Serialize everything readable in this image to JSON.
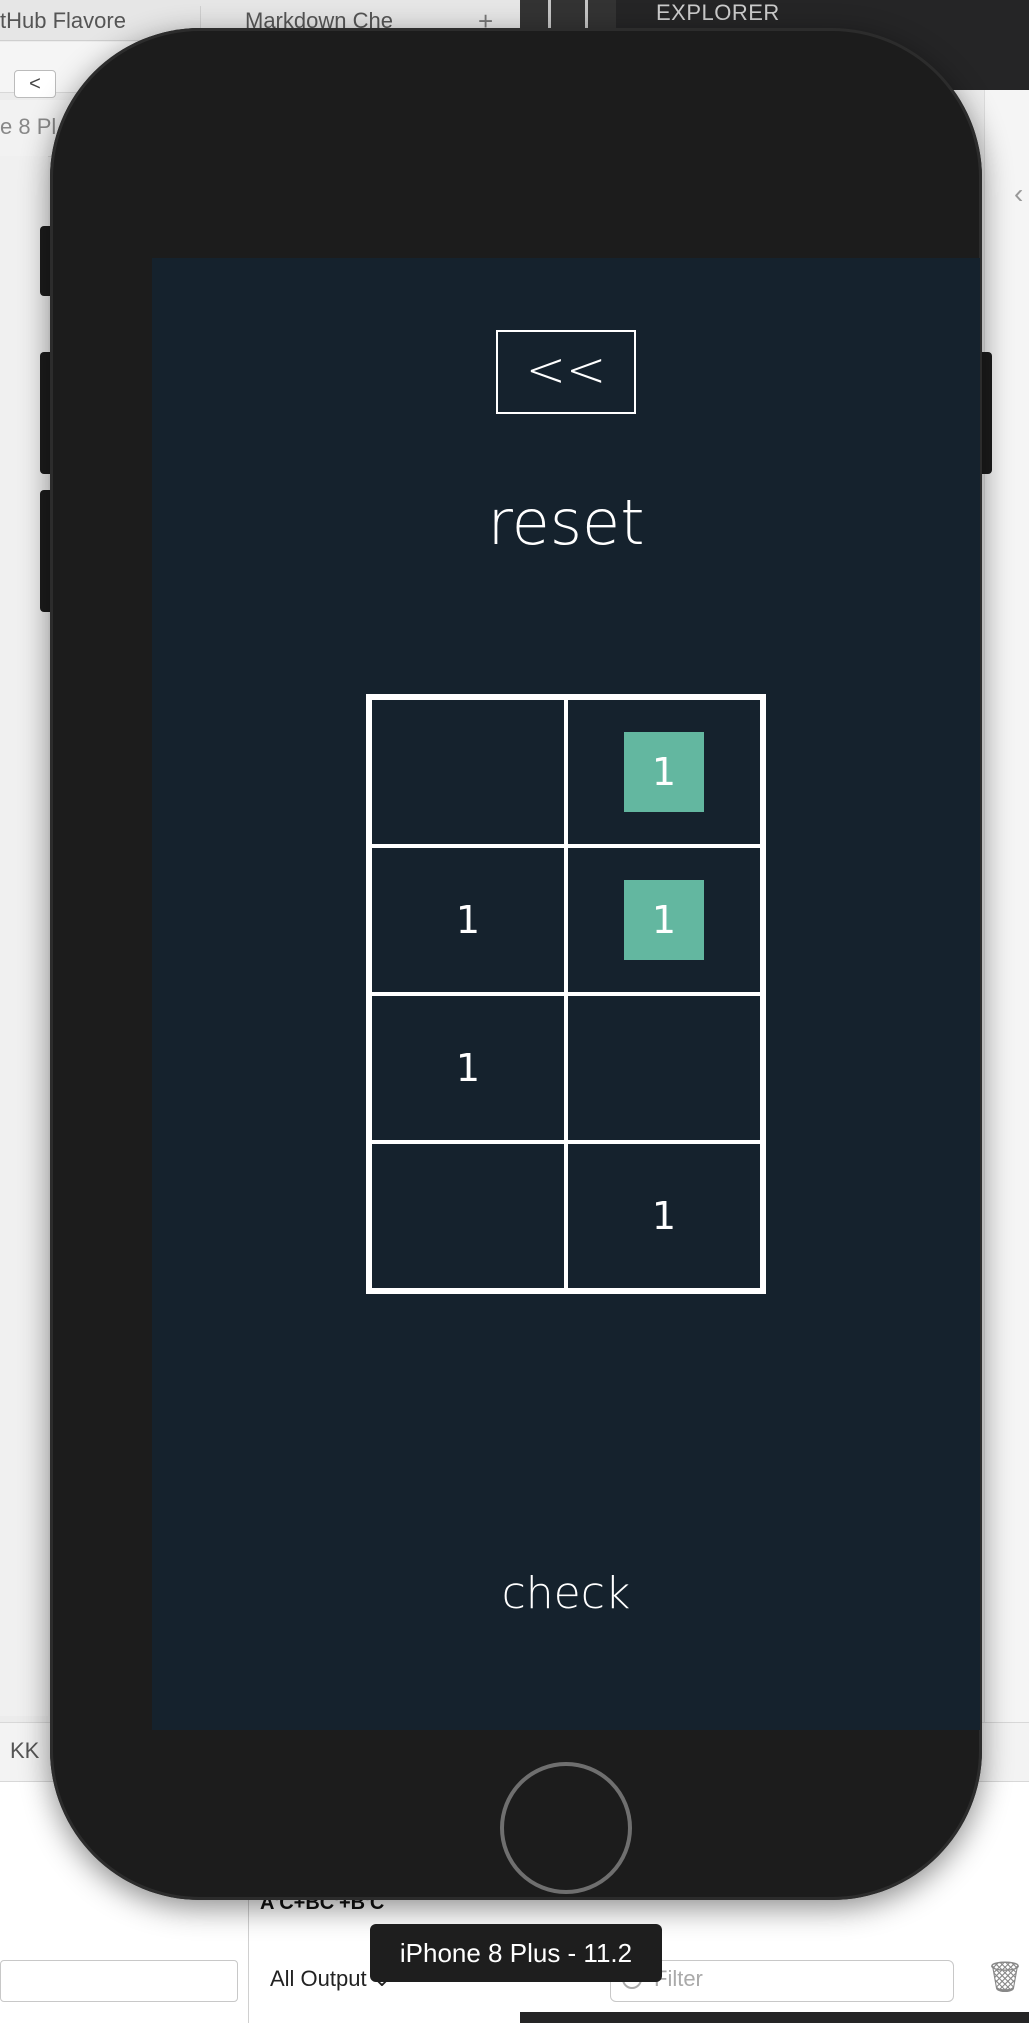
{
  "background": {
    "tabs": [
      "tHub Flavore",
      "Markdown Che"
    ],
    "back_label": "<",
    "row3_text": "e 8 Pl",
    "explorer_title": "EXPLORER",
    "kk_label": "KK",
    "formula": "A'C+BC'+B'C",
    "output_select": "All Output ⌄",
    "filter_placeholder": "Filter"
  },
  "simulator": {
    "label": "iPhone 8 Plus - 11.2"
  },
  "app": {
    "back_button": "<<",
    "reset_label": "reset",
    "check_label": "check",
    "grid": {
      "rows": [
        [
          {
            "value": "",
            "highlight": false
          },
          {
            "value": "1",
            "highlight": true
          }
        ],
        [
          {
            "value": "1",
            "highlight": false
          },
          {
            "value": "1",
            "highlight": true
          }
        ],
        [
          {
            "value": "1",
            "highlight": false
          },
          {
            "value": "",
            "highlight": false
          }
        ],
        [
          {
            "value": "",
            "highlight": false
          },
          {
            "value": "1",
            "highlight": false
          }
        ]
      ]
    }
  },
  "colors": {
    "screen_bg": "#15222d",
    "highlight": "#63b7a0",
    "device": "#1c1c1c"
  }
}
